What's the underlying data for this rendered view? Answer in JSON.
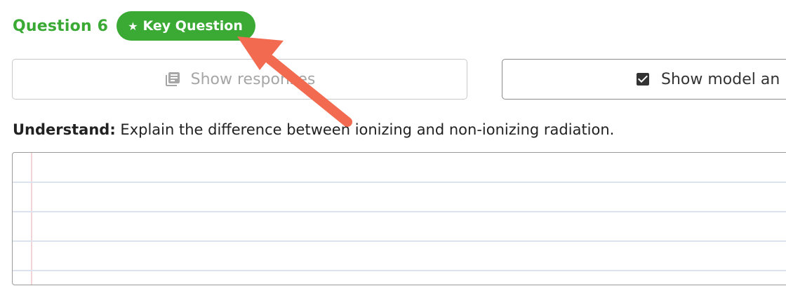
{
  "question": {
    "number_label": "Question 6",
    "key_badge": {
      "label": "Key Question",
      "icon": "star-icon"
    }
  },
  "buttons": {
    "show_responses": {
      "label": "Show responses",
      "icon": "list-icon",
      "state": "disabled"
    },
    "show_model_answer": {
      "label": "Show model an",
      "icon": "checkbox-icon"
    }
  },
  "prompt": {
    "label": "Understand:",
    "text": "Explain the difference between ionizing and non-ionizing radiation."
  },
  "answer_box": {
    "value": "",
    "style": "lined-notebook-paper"
  },
  "colors": {
    "accent_green": "#3aaa35",
    "annotation_arrow": "#f26a4f",
    "disabled_text": "#a6a6a6"
  }
}
